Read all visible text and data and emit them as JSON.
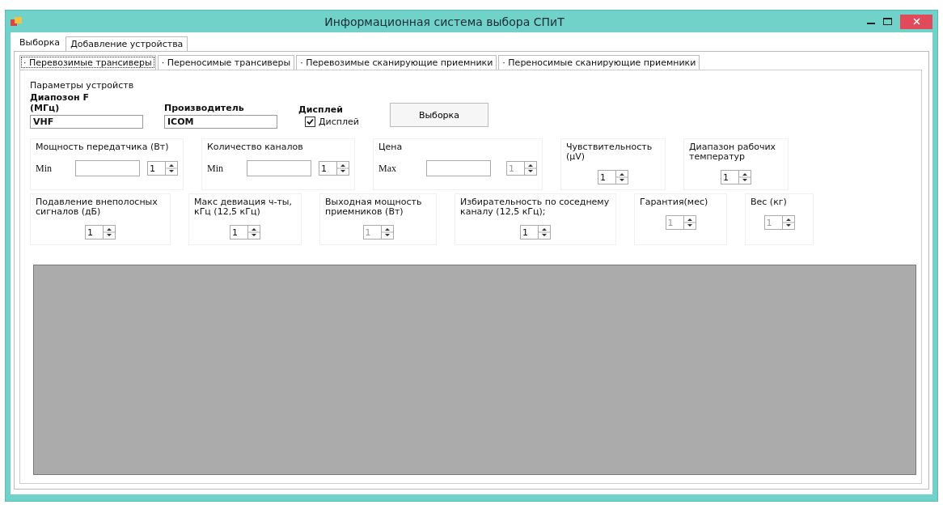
{
  "window": {
    "title": "Информационная система выбора СПиТ"
  },
  "main_tabs": [
    {
      "label": "Выборка",
      "selected": true
    },
    {
      "label": "Добавление устройства",
      "selected": false
    }
  ],
  "sub_tabs": [
    {
      "label": "· Перевозимые трансиверы",
      "selected": true
    },
    {
      "label": "· Переносимые трансиверы",
      "selected": false
    },
    {
      "label": "· Перевозимые сканирующие приемники",
      "selected": false
    },
    {
      "label": "· Переносимые сканирующие приемники",
      "selected": false
    }
  ],
  "params": {
    "title": "Параметры устройств",
    "text_fields": [
      {
        "label": "Диапозон F (МГц)",
        "value": "VHF"
      },
      {
        "label": "Производитель",
        "value": "ICOM"
      }
    ],
    "display": {
      "label": "Дисплей",
      "checkbox_label": "Дисплей",
      "checked": true
    },
    "button": "Выборка"
  },
  "row_1": [
    {
      "kind": "range",
      "label": "Мощность передатчика (Вт)",
      "bound": "Min",
      "spin": "1",
      "disabled": false
    },
    {
      "kind": "range",
      "label": "Количество каналов",
      "bound": "Min",
      "spin": "1",
      "disabled": false
    },
    {
      "kind": "range",
      "label": "Цена",
      "bound": "Max",
      "spin": "1",
      "disabled": true
    },
    {
      "kind": "spin",
      "label": "Чувствительность (μV)",
      "spin": "1",
      "disabled": false
    },
    {
      "kind": "spin",
      "label": "Диапазон рабочих температур",
      "spin": "1",
      "disabled": false
    }
  ],
  "row_2": [
    {
      "kind": "spin",
      "label": "Подавление внеполосных сигналов (дБ)",
      "spin": "1",
      "disabled": false
    },
    {
      "kind": "spin",
      "label": "Макс девиация ч-ты, кГц (12,5 кГц)",
      "spin": "1",
      "disabled": false
    },
    {
      "kind": "spin",
      "label": "Выходная мощность приемников (Вт)",
      "spin": "1",
      "disabled": true
    },
    {
      "kind": "spin",
      "label": "Избирательность по соседнему каналу (12,5 кГц);",
      "spin": "1",
      "disabled": false
    },
    {
      "kind": "spin",
      "label": "Гарантия(мес)",
      "spin": "1",
      "disabled": true
    },
    {
      "kind": "spin",
      "label": "Вес (кг)",
      "spin": "1",
      "disabled": true
    }
  ]
}
